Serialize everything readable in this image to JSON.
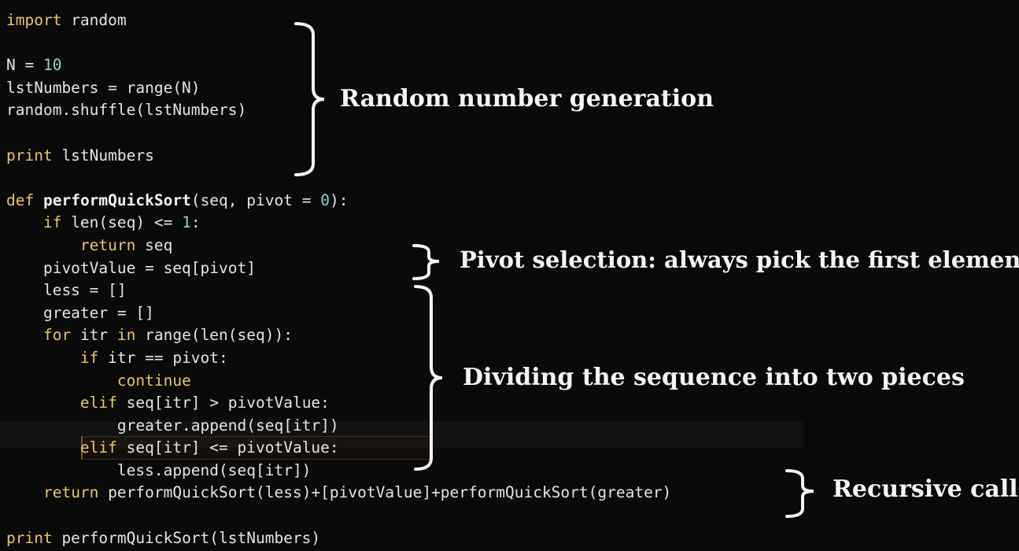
{
  "code": [
    [
      {
        "t": "import",
        "c": "kw"
      },
      {
        "t": " random"
      }
    ],
    [
      {
        "t": ""
      }
    ],
    [
      {
        "t": "N = "
      },
      {
        "t": "10",
        "c": "num"
      }
    ],
    [
      {
        "t": "lstNumbers = range(N)"
      }
    ],
    [
      {
        "t": "random.shuffle(lstNumbers)"
      }
    ],
    [
      {
        "t": ""
      }
    ],
    [
      {
        "t": "print",
        "c": "kw"
      },
      {
        "t": " lstNumbers"
      }
    ],
    [
      {
        "t": ""
      }
    ],
    [
      {
        "t": "def",
        "c": "kw"
      },
      {
        "t": " "
      },
      {
        "t": "performQuickSort",
        "c": "fn"
      },
      {
        "t": "(seq, pivot = "
      },
      {
        "t": "0",
        "c": "num"
      },
      {
        "t": "):"
      }
    ],
    [
      {
        "t": "    "
      },
      {
        "t": "if",
        "c": "kw"
      },
      {
        "t": " len(seq) <= "
      },
      {
        "t": "1",
        "c": "num"
      },
      {
        "t": ":"
      }
    ],
    [
      {
        "t": "        "
      },
      {
        "t": "return",
        "c": "kw"
      },
      {
        "t": " seq"
      }
    ],
    [
      {
        "t": "    pivotValue = seq[pivot]"
      }
    ],
    [
      {
        "t": "    less = []"
      }
    ],
    [
      {
        "t": "    greater = []"
      }
    ],
    [
      {
        "t": "    "
      },
      {
        "t": "for",
        "c": "kw"
      },
      {
        "t": " itr "
      },
      {
        "t": "in",
        "c": "kw"
      },
      {
        "t": " range(len(seq)):"
      }
    ],
    [
      {
        "t": "        "
      },
      {
        "t": "if",
        "c": "kw"
      },
      {
        "t": " itr == pivot:"
      }
    ],
    [
      {
        "t": "            "
      },
      {
        "t": "continue",
        "c": "kw"
      }
    ],
    [
      {
        "t": "        "
      },
      {
        "t": "elif",
        "c": "kw"
      },
      {
        "t": " seq[itr] > pivotValue:"
      }
    ],
    [
      {
        "t": "            greater.append(seq[itr])"
      }
    ],
    [
      {
        "t": "        "
      },
      {
        "t": "elif",
        "c": "kw"
      },
      {
        "t": " seq[itr] <= pivotValue:"
      }
    ],
    [
      {
        "t": "            less.append(seq[itr])"
      }
    ],
    [
      {
        "t": "    "
      },
      {
        "t": "return",
        "c": "kw"
      },
      {
        "t": " performQuickSort(less)+[pivotValue]+performQuickSort(greater)"
      }
    ],
    [
      {
        "t": ""
      }
    ],
    [
      {
        "t": "print",
        "c": "kw"
      },
      {
        "t": " performQuickSort(lstNumbers)"
      }
    ]
  ],
  "annotations": {
    "random_gen": "Random number generation",
    "pivot": "Pivot selection: always pick the first element",
    "divide": "Dividing the sequence into two pieces",
    "recursive": "Recursive calls"
  },
  "colors": {
    "background": "#0a0a0a",
    "keyword": "#e9c46a",
    "number": "#8fd3d0",
    "text": "#e4e4e4",
    "bracket": "#f4f4f4"
  }
}
